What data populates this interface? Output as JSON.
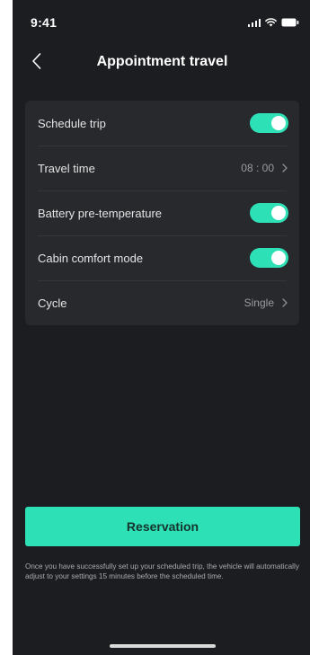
{
  "status_bar": {
    "time": "9:41"
  },
  "nav": {
    "title": "Appointment travel",
    "back_icon": "chevron-left-icon"
  },
  "settings": {
    "schedule_trip": {
      "label": "Schedule trip",
      "enabled": true
    },
    "travel_time": {
      "label": "Travel time",
      "value": "08 : 00"
    },
    "battery_pre_temperature": {
      "label": "Battery pre-temperature",
      "enabled": true
    },
    "cabin_comfort_mode": {
      "label": "Cabin comfort mode",
      "enabled": true
    },
    "cycle": {
      "label": "Cycle",
      "value": "Single"
    }
  },
  "reservation": {
    "button_label": "Reservation",
    "note": "Once you have successfully set up your scheduled trip, the vehicle will automatically adjust to your settings 15 minutes before the scheduled time."
  },
  "colors": {
    "accent": "#2de0b6",
    "background": "#1c1d20",
    "card": "#28292d"
  }
}
